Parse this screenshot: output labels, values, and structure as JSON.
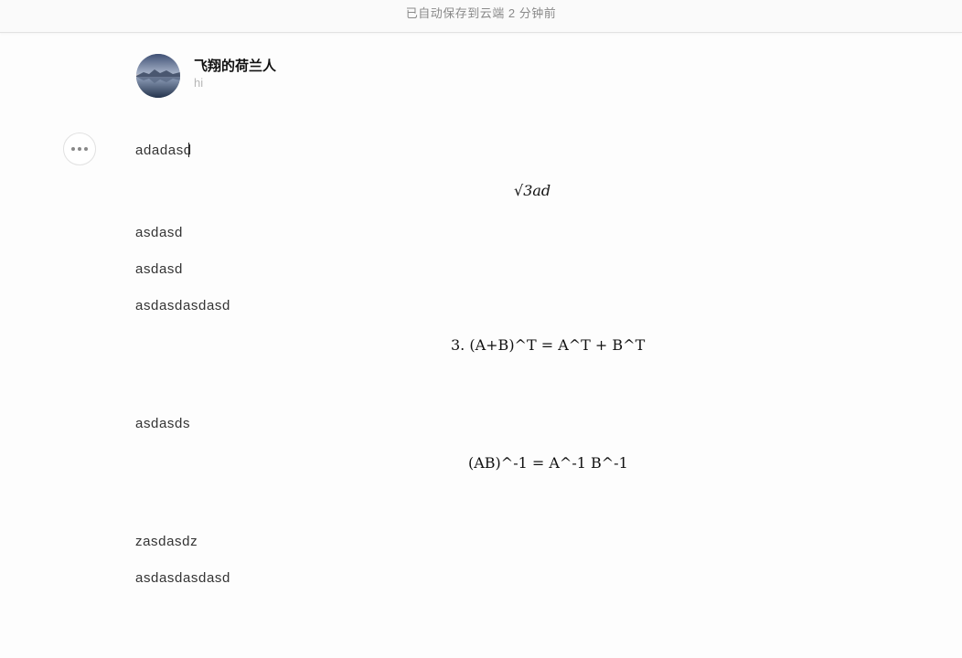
{
  "header": {
    "save_status": "已自动保存到云端 2 分钟前"
  },
  "author": {
    "name": "飞翔的荷兰人",
    "subtitle": "hi"
  },
  "paragraphs": {
    "p1": "adadasd",
    "p2": "asdasd",
    "p3": "asdasd",
    "p4": "asdasdasdasd",
    "p5": "asdasds",
    "p6": "zasdasdz",
    "p7": "asdasdasdasd"
  },
  "formulas": {
    "f1": "√3ad",
    "f2": "3. (A+B)^T = A^T + B^T",
    "f3": "(AB)^-1 = A^-1 B^-1"
  }
}
